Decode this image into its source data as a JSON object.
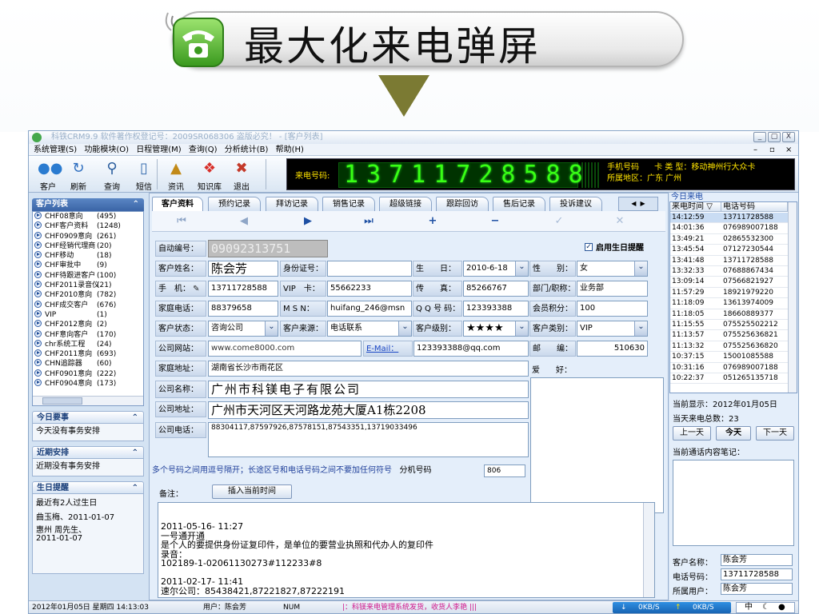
{
  "banner": {
    "title": "最大化来电弹屏"
  },
  "window": {
    "title": "科铁CRM9.9 软件著作权登记号：2009SR068306 盗版必究！ - [客户列表]",
    "minimize": "_",
    "restore": "▢",
    "close": "X"
  },
  "menu": {
    "items": [
      "系统管理(S)",
      "功能模块(O)",
      "日程管理(M)",
      "查询(Q)",
      "分析统计(B)",
      "帮助(H)"
    ],
    "mdi": [
      "–",
      "▫",
      "×"
    ]
  },
  "toolbar": {
    "items": [
      "客户",
      "刷新",
      "查询",
      "短信",
      "资讯",
      "知识库",
      "退出"
    ]
  },
  "caller": {
    "label": "来电号码:",
    "number": "13711728588",
    "type_label": "手机号码",
    "card_type": "卡 类 型：移动神州行大众卡",
    "region": "所属地区：广东 广州"
  },
  "sidebar": {
    "customer_list": {
      "title": "客户列表",
      "items": [
        {
          "name": "CHF08意向",
          "count": "(495)"
        },
        {
          "name": "CHF客户资料",
          "count": "(1248)"
        },
        {
          "name": "CHF0909意向",
          "count": "(261)"
        },
        {
          "name": "CHF经销代理商",
          "count": "(20)"
        },
        {
          "name": "CHF移动",
          "count": "(18)"
        },
        {
          "name": "CHF审批中",
          "count": "(9)"
        },
        {
          "name": "CHF待跟进客户",
          "count": "(100)"
        },
        {
          "name": "CHF2011录音仪",
          "count": "(21)"
        },
        {
          "name": "CHF2010意向",
          "count": "(782)"
        },
        {
          "name": "CHF成交客户",
          "count": "(676)"
        },
        {
          "name": "VIP",
          "count": "(1)"
        },
        {
          "name": "CHF2012意向",
          "count": "(2)"
        },
        {
          "name": "CHF意向客户",
          "count": "(170)"
        },
        {
          "name": "chr系统工程",
          "count": "(24)"
        },
        {
          "name": "CHF2011意向",
          "count": "(693)"
        },
        {
          "name": "CHN追踪器",
          "count": "(60)"
        },
        {
          "name": "CHF0901意向",
          "count": "(222)"
        },
        {
          "name": "CHF0904意向",
          "count": "(173)"
        }
      ]
    },
    "today": {
      "title": "今日要事",
      "text": "今天没有事务安排"
    },
    "recent": {
      "title": "近期安排",
      "text": "近期没有事务安排"
    },
    "birthday": {
      "title": "生日提醒",
      "line1": "最近有2人过生日",
      "line2": "曲玉梅、2011-01-07",
      "line3": "惠州 周先生、",
      "line4": "2011-01-07"
    }
  },
  "tabs": [
    "客户资料",
    "预约记录",
    "拜访记录",
    "销售记录",
    "超级链接",
    "跟踪回访",
    "售后记录",
    "投诉建议"
  ],
  "nav": [
    "⏮",
    "◀",
    "▶",
    "⏭",
    "+",
    "−",
    "✓",
    "✕"
  ],
  "form": {
    "serial_label": "自动编号：",
    "serial": "09092313751",
    "birthday_check": "启用生日提醒",
    "check_mark": "✓",
    "name_label": "客户姓名：",
    "name": "陈会芳",
    "id_label": "身份证号：",
    "id": "",
    "birth_label": "生　　日：",
    "birth": "2010-6-18",
    "gender_label": "性　　别：",
    "gender": "女",
    "mobile_label": "手　机：",
    "mobile": "13711728588",
    "vip_label": "VIP　卡：",
    "vip": "55662233",
    "fax_label": "传　　真：",
    "fax": "85266767",
    "dept_label": "部门/职称：",
    "dept": "业务部",
    "home_label": "家庭电话：",
    "home": "88379658",
    "msn_label": "M S N：",
    "msn": "huifang_246@msn",
    "qq_label": "Q Q 号 码：",
    "qq": "123393388",
    "points_label": "会员积分：",
    "points": "100",
    "status_label": "客户状态：",
    "status": "咨询公司",
    "source_label": "客户来源：",
    "source": "电话联系",
    "level_label": "客户级别：",
    "level": "★★★★",
    "category_label": "客户类别：",
    "category": "VIP",
    "web_label": "公司网站：",
    "web": "www.come8000.com",
    "email_label": "E-Mail：",
    "email": "123393388@qq.com",
    "zip_label": "邮　　编：",
    "zip": "510630",
    "addr_label": "家庭地址：",
    "addr": "湖南省长沙市雨花区",
    "hobby_label": "爱　　好：",
    "company_label": "公司名称：",
    "company": "广州市科镁电子有限公司",
    "caddr_label": "公司地址：",
    "caddr": "广州市天河区天河路龙苑大厦A1栋2208",
    "cphone_label": "公司电话：",
    "cphone": "88304117,87597926,87578151,87543351,13719033496",
    "hint": "多个号码之间用逗号隔开；长途区号和电话号码之间不要加任何符号",
    "ext_label": "分机号码",
    "ext": "806",
    "remark_label": "备注：",
    "insert_btn": "插入当前时间",
    "notes": "2011-05-16- 11:27\n一号通开通\n是个人的要提供身份证复印件，是单位的要营业执照和代办人的复印件\n录音：\n102189-1-02061130273#112233#8\n\n2011-02-17- 11:41\n速尔公司：85438421,87221827,87222191"
  },
  "calls": {
    "title": "今日来电",
    "col_time": "来电时间",
    "col_phone": "电话号码",
    "rows": [
      {
        "time": "14:12:59",
        "phone": "13711728588"
      },
      {
        "time": "14:01:36",
        "phone": "076989007188"
      },
      {
        "time": "13:49:21",
        "phone": "02865532300"
      },
      {
        "time": "13:45:54",
        "phone": "07127230544"
      },
      {
        "time": "13:41:48",
        "phone": "13711728588"
      },
      {
        "time": "13:32:33",
        "phone": "07688867434"
      },
      {
        "time": "13:09:14",
        "phone": "07566821927"
      },
      {
        "time": "11:57:29",
        "phone": "18921979220"
      },
      {
        "time": "11:18:09",
        "phone": "13613974009"
      },
      {
        "time": "11:18:05",
        "phone": "18660889377"
      },
      {
        "time": "11:15:55",
        "phone": "075525502212"
      },
      {
        "time": "11:13:57",
        "phone": "075525636821"
      },
      {
        "time": "11:13:32",
        "phone": "075525636820"
      },
      {
        "time": "10:37:15",
        "phone": "15001085588"
      },
      {
        "time": "10:31:16",
        "phone": "076989007188"
      },
      {
        "time": "10:22:37",
        "phone": "051265135718"
      }
    ],
    "current_display": "当前显示：2012年01月05日",
    "total": "当天来电总数：23",
    "prev_btn": "上一天",
    "today_btn": "今天",
    "next_btn": "下一天",
    "note_label": "当前通话内容笔记：",
    "cust_name_label": "客户名称：",
    "cust_name": "陈会芳",
    "phone_label": "电话号码：",
    "phone": "13711728588",
    "owner_label": "所属用户：",
    "owner": "陈会芳"
  },
  "status": {
    "datetime": "2012年01月05日 星期四 14:13:03",
    "user": "用户：陈会芳",
    "num": "NUM",
    "marquee": "|：科镁来电管理系统发货，收货人李艳 |||",
    "down": "0KB/S",
    "up": "0KB/S",
    "ime": "中"
  },
  "colors": {
    "accent": "#3a64a6",
    "led": "#39ff14",
    "caller_text": "#ffe400"
  }
}
